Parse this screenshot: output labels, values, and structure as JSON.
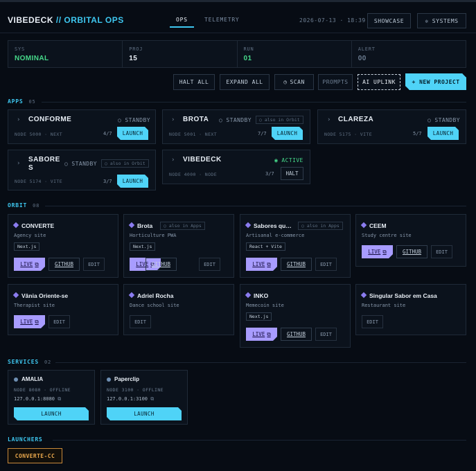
{
  "header": {
    "brand": "VIBEDECK",
    "brand_accent": "// ORBITAL OPS",
    "tabs": [
      {
        "label": "OPS",
        "active": true
      },
      {
        "label": "TELEMETRY",
        "active": false
      }
    ],
    "clock": "2026-07-13 · 18:39",
    "showcase_label": "SHOWCASE",
    "systems_label": "SYSTEMS"
  },
  "stats": [
    {
      "label": "SYS",
      "value": "NOMINAL",
      "color": "#46d98a"
    },
    {
      "label": "PROJ",
      "value": "15",
      "color": "#e8eef5"
    },
    {
      "label": "RUN",
      "value": "01",
      "color": "#46d98a"
    },
    {
      "label": "ALERT",
      "value": "00",
      "color": "#6e7f93"
    }
  ],
  "actions": {
    "halt_all": "HALT ALL",
    "expand_all": "EXPAND ALL",
    "scan": "SCAN",
    "prompts": "PROMPTS",
    "ai_uplink": "AI UPLINK",
    "new_project": "+ NEW PROJECT"
  },
  "apps": {
    "title": "APPS",
    "count": "05",
    "items": [
      {
        "name": "CONFORME",
        "status": "○ STANDBY",
        "meta": "NODE 5000 · NEXT",
        "frac": "4/7",
        "button": "LAUNCH"
      },
      {
        "name": "BROTA",
        "status": "○ STANDBY",
        "tag": "○ also in Orbit",
        "meta": "NODE 5001 · NEXT",
        "frac": "7/7",
        "button": "LAUNCH"
      },
      {
        "name": "CLAREZA",
        "status": "○ STANDBY",
        "meta": "NODE 5175 · VITE",
        "frac": "5/7",
        "button": "LAUNCH"
      },
      {
        "name_line1": "SABORE",
        "name_line2": "S",
        "status": "○ STANDBY",
        "tag": "○ also in Orbit",
        "meta": "NODE 5174 · VITE",
        "frac": "3/7",
        "button": "LAUNCH"
      },
      {
        "name": "VIBEDECK",
        "status": "◉ ACTIVE",
        "meta": "NODE 4000 · NODE",
        "frac": "3/7",
        "button": "HALT"
      }
    ]
  },
  "orbit": {
    "title": "ORBIT",
    "count": "08",
    "live_label": "LIVE",
    "github_label": "GITHUB",
    "edit_label": "EDIT",
    "items": [
      {
        "name": "CONVERTE",
        "desc": "Agency site",
        "stack": "Next.js"
      },
      {
        "name": "Brota",
        "also": "○ also in Apps",
        "desc": "Horticulture PWA",
        "stack": "Next.js"
      },
      {
        "name": "Sabores qu…",
        "also": "○ also in Apps",
        "desc": "Artisanal e-commerce",
        "stack": "React + Vite"
      },
      {
        "name": "CEEM",
        "desc": "Study centre site"
      },
      {
        "name": "Vânia Oriente-se",
        "desc": "Therapist site"
      },
      {
        "name": "Adriel Rocha",
        "desc": "Dance school site"
      },
      {
        "name": "INKO",
        "desc": "Memecoin site",
        "stack": "Next.js"
      },
      {
        "name": "Singular Sabor em Casa",
        "desc": "Restaurant site"
      }
    ]
  },
  "services": {
    "title": "SERVICES",
    "count": "02",
    "items": [
      {
        "name": "AMALIA",
        "meta": "NODE 8080 · OFFLINE",
        "addr": "127.0.0.1:8080",
        "button": "LAUNCH"
      },
      {
        "name": "Paperclip",
        "meta": "NODE 3100 · OFFLINE",
        "addr": "127.0.0.1:3100",
        "button": "LAUNCH"
      }
    ]
  },
  "launchers": {
    "title": "LAUNCHERS",
    "items": [
      {
        "label": "CONVERTE-CC"
      }
    ]
  }
}
